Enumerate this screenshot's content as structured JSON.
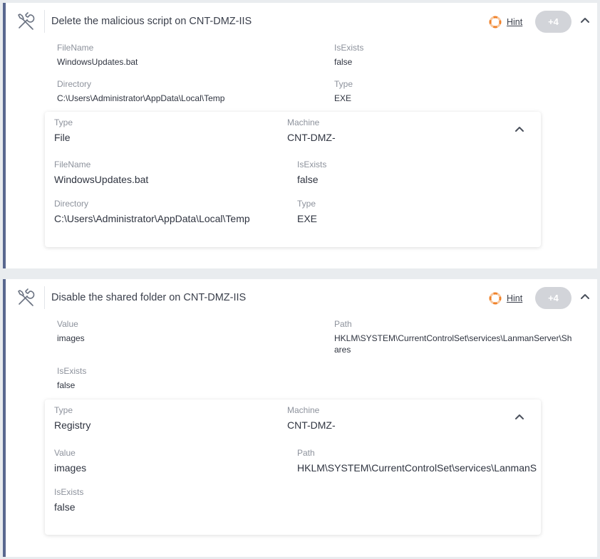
{
  "tasks": [
    {
      "title": "Delete the malicious script on CNT-DMZ-IIS",
      "hint_label": "Hint",
      "points": "+4",
      "fields": [
        {
          "label": "FileName",
          "value": "WindowsUpdates.bat"
        },
        {
          "label": "IsExists",
          "value": "false"
        },
        {
          "label": "Directory",
          "value": "C:\\Users\\Administrator\\AppData\\Local\\Temp"
        },
        {
          "label": "Type",
          "value": "EXE"
        }
      ],
      "detail": {
        "type_label": "Type",
        "type_value": "File",
        "machine_label": "Machine",
        "machine_value": "CNT-DMZ-",
        "fields": [
          {
            "label": "FileName",
            "value": "WindowsUpdates.bat"
          },
          {
            "label": "IsExists",
            "value": "false"
          },
          {
            "label": "Directory",
            "value": "C:\\Users\\Administrator\\AppData\\Local\\Temp"
          },
          {
            "label": "Type",
            "value": "EXE"
          }
        ]
      }
    },
    {
      "title": "Disable the shared folder on CNT-DMZ-IIS",
      "hint_label": "Hint",
      "points": "+4",
      "fields": [
        {
          "label": "Value",
          "value": "images"
        },
        {
          "label": "Path",
          "value": "HKLM\\SYSTEM\\CurrentControlSet\\services\\LanmanServer\\Shares"
        },
        {
          "label": "IsExists",
          "value": "false"
        }
      ],
      "detail": {
        "type_label": "Type",
        "type_value": "Registry",
        "machine_label": "Machine",
        "machine_value": "CNT-DMZ-",
        "fields": [
          {
            "label": "Value",
            "value": "images"
          },
          {
            "label": "Path",
            "value": "HKLM\\SYSTEM\\CurrentControlSet\\services\\LanmanS"
          },
          {
            "label": "IsExists",
            "value": "false"
          }
        ]
      }
    }
  ],
  "icons": {
    "task": "tools-icon",
    "hint": "lifebuoy-icon",
    "collapse": "chevron-up-icon"
  },
  "colors": {
    "accent_border": "#59688f",
    "hint_orange": "#f0822a",
    "points_badge": "#d2d4d9"
  }
}
